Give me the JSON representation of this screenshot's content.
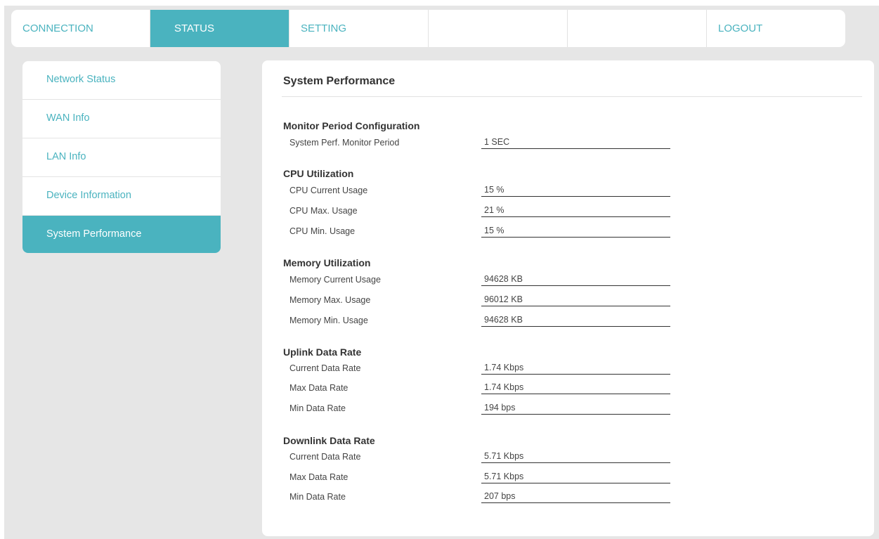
{
  "topnav": {
    "tabs": [
      {
        "label": "CONNECTION"
      },
      {
        "label": "STATUS",
        "active": true
      },
      {
        "label": "SETTING"
      },
      {
        "label": ""
      },
      {
        "label": ""
      },
      {
        "label": "LOGOUT"
      }
    ]
  },
  "sidebar": {
    "items": [
      {
        "label": "Network Status"
      },
      {
        "label": "WAN Info"
      },
      {
        "label": "LAN Info"
      },
      {
        "label": "Device Information"
      },
      {
        "label": "System Performance",
        "active": true
      }
    ]
  },
  "main": {
    "title": "System Performance",
    "monitor": {
      "title": "Monitor Period Configuration",
      "period_label": "System Perf. Monitor Period",
      "period_value": "1 SEC"
    },
    "cpu": {
      "title": "CPU Utilization",
      "rows": [
        {
          "label": "CPU Current Usage",
          "value": "15 %"
        },
        {
          "label": "CPU Max. Usage",
          "value": "21 %"
        },
        {
          "label": "CPU Min. Usage",
          "value": "15 %"
        }
      ]
    },
    "memory": {
      "title": "Memory Utilization",
      "rows": [
        {
          "label": "Memory Current Usage",
          "value": "94628 KB"
        },
        {
          "label": "Memory Max. Usage",
          "value": "96012 KB"
        },
        {
          "label": "Memory Min. Usage",
          "value": "94628 KB"
        }
      ]
    },
    "uplink": {
      "title": "Uplink Data Rate",
      "rows": [
        {
          "label": "Current Data Rate",
          "value": "1.74 Kbps"
        },
        {
          "label": "Max Data Rate",
          "value": "1.74 Kbps"
        },
        {
          "label": "Min Data Rate",
          "value": "194 bps"
        }
      ]
    },
    "downlink": {
      "title": "Downlink Data Rate",
      "rows": [
        {
          "label": "Current Data Rate",
          "value": "5.71 Kbps"
        },
        {
          "label": "Max Data Rate",
          "value": "5.71 Kbps"
        },
        {
          "label": "Min Data Rate",
          "value": "207 bps"
        }
      ]
    }
  },
  "colors": {
    "accent": "#4ab3bf",
    "background": "#e6e6e6",
    "panel": "#ffffff",
    "text": "#333333"
  }
}
